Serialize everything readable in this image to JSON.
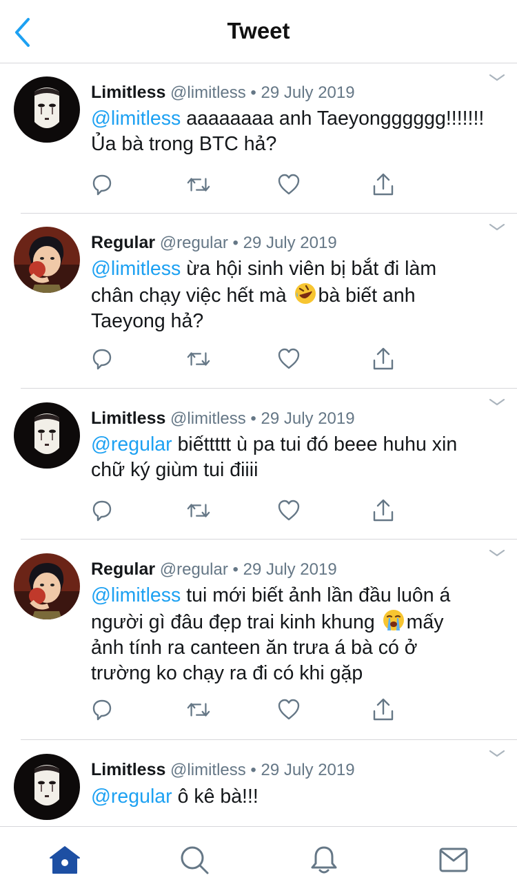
{
  "header": {
    "title": "Tweet"
  },
  "tweets": [
    {
      "name": "Limitless",
      "handle": "@limitless",
      "date": "29 July 2019",
      "mention": "@limitless",
      "lines": [
        " aaaaaaaa anh Taeyongggggg!!!!!!!",
        "Ủa bà trong BTC hả?"
      ]
    },
    {
      "name": "Regular",
      "handle": "@regular",
      "date": "29 July 2019",
      "mention": "@limitless",
      "l1": " ừa hội sinh viên bị bắt đi làm",
      "l2a": "chân chạy việc hết mà ",
      "emoji": "rolling-on-floor-laughing-emoji",
      "l2b": "bà biết anh",
      "l3": "Taeyong hả?"
    },
    {
      "name": "Limitless",
      "handle": "@limitless",
      "date": "29 July 2019",
      "mention": "@regular",
      "lines": [
        " biếttttt ù pa tui đó beee huhu xin",
        "chữ ký giùm tui điiii"
      ]
    },
    {
      "name": "Regular",
      "handle": "@regular",
      "date": "29 July 2019",
      "mention": "@limitless",
      "l1": " tui mới biết ảnh lần đầu luôn á",
      "l2a": "người gì đâu đẹp trai kinh khung ",
      "emoji": "loudly-crying-emoji",
      "l2b": "mấy",
      "l3": "ảnh tính ra canteen ăn trưa á bà có ở",
      "l4": "trường ko chạy ra đi có khi gặp"
    },
    {
      "name": "Limitless",
      "handle": "@limitless",
      "date": "29 July 2019",
      "mention": "@regular",
      "lines": [
        " ô kê bà!!!"
      ]
    }
  ],
  "separator": " • ",
  "colors": {
    "accent": "#1da1f2",
    "secondary": "#657786",
    "tabActive": "#1d4fa3",
    "divider": "#d6d6da"
  },
  "tabs": [
    "home-icon",
    "search-icon",
    "notifications-icon",
    "messages-icon"
  ]
}
